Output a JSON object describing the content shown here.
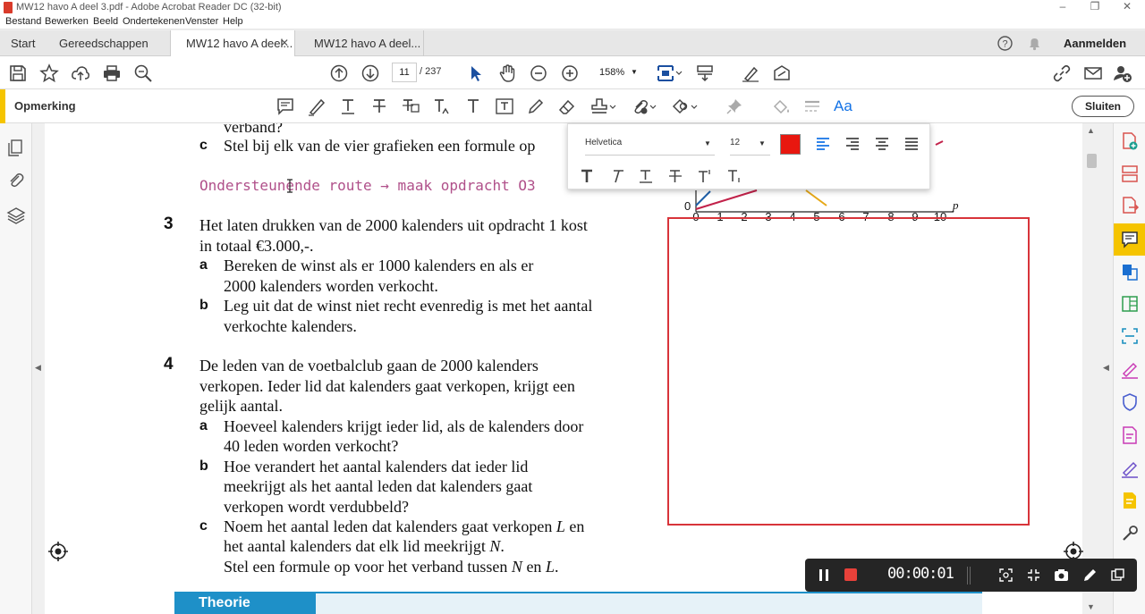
{
  "window": {
    "title": "MW12 havo A deel 3.pdf - Adobe Acrobat Reader DC (32-bit)"
  },
  "menu": [
    "Bestand",
    "Bewerken",
    "Beeld",
    "Ondertekenen",
    "Venster",
    "Help"
  ],
  "tabs": {
    "start": "Start",
    "tools": "Gereedschappen",
    "doc1": "MW12 havo A deel...",
    "doc2": "MW12 havo A deel...",
    "signin": "Aanmelden"
  },
  "toolbar": {
    "page_current": "11",
    "page_total": "/ 237",
    "zoom": "158%"
  },
  "comment": {
    "label": "Opmerking",
    "close": "Sluiten",
    "font_icon": "Aa"
  },
  "popup": {
    "font": "Helvetica",
    "size": "12",
    "color": "#e8170f"
  },
  "doc": {
    "frag_top": "verband?",
    "q2c_letter": "c",
    "q2c_text": "Stel bij elk van de vier grafieken een formule op",
    "route": "Ondersteunende route → maak opdracht O3",
    "q3_num": "3",
    "q3_l1": "Het laten drukken van de 2000 kalenders uit opdracht 1 kost",
    "q3_l2": "in totaal €3.000,-.",
    "q3a_letter": "a",
    "q3a_l1": "Bereken de winst als er 1000 kalenders en als er",
    "q3a_l2": "2000 kalenders worden verkocht.",
    "q3b_letter": "b",
    "q3b_l1": "Leg uit dat de winst niet recht evenredig is met het aantal",
    "q3b_l2": "verkochte kalenders.",
    "q4_num": "4",
    "q4_l1": "De leden van de voetbalclub gaan de 2000 kalenders",
    "q4_l2": "verkopen. Ieder lid dat kalenders gaat verkopen, krijgt een",
    "q4_l3": "gelijk aantal.",
    "q4a_letter": "a",
    "q4a_l1": "Hoeveel kalenders krijgt ieder lid, als de kalenders door",
    "q4a_l2": "40 leden worden verkocht?",
    "q4b_letter": "b",
    "q4b_l1": "Hoe verandert het aantal kalenders dat ieder lid",
    "q4b_l2": "meekrijgt als het aantal leden dat kalenders gaat",
    "q4b_l3": "verkopen wordt verdubbeld?",
    "q4c_letter": "c",
    "q4c_l1a": "Noem het aantal leden dat kalenders gaat verkopen ",
    "q4c_L": "L",
    "q4c_l1b": " en",
    "q4c_l2a": "het aantal kalenders dat elk lid meekrijgt ",
    "q4c_N": "N",
    "q4c_l2b": ".",
    "q4c_l3a": "Stel een formule op voor het verband tussen ",
    "q4c_N2": "N",
    "q4c_l3b": " en ",
    "q4c_L2": "L",
    "q4c_l3c": ".",
    "theorie": "Theorie",
    "graph_ticks": [
      "0",
      "1",
      "2",
      "3",
      "4",
      "5",
      "6",
      "7",
      "8",
      "9",
      "10"
    ],
    "graph_axis": "p"
  },
  "recorder": {
    "time": "00:00:01"
  }
}
